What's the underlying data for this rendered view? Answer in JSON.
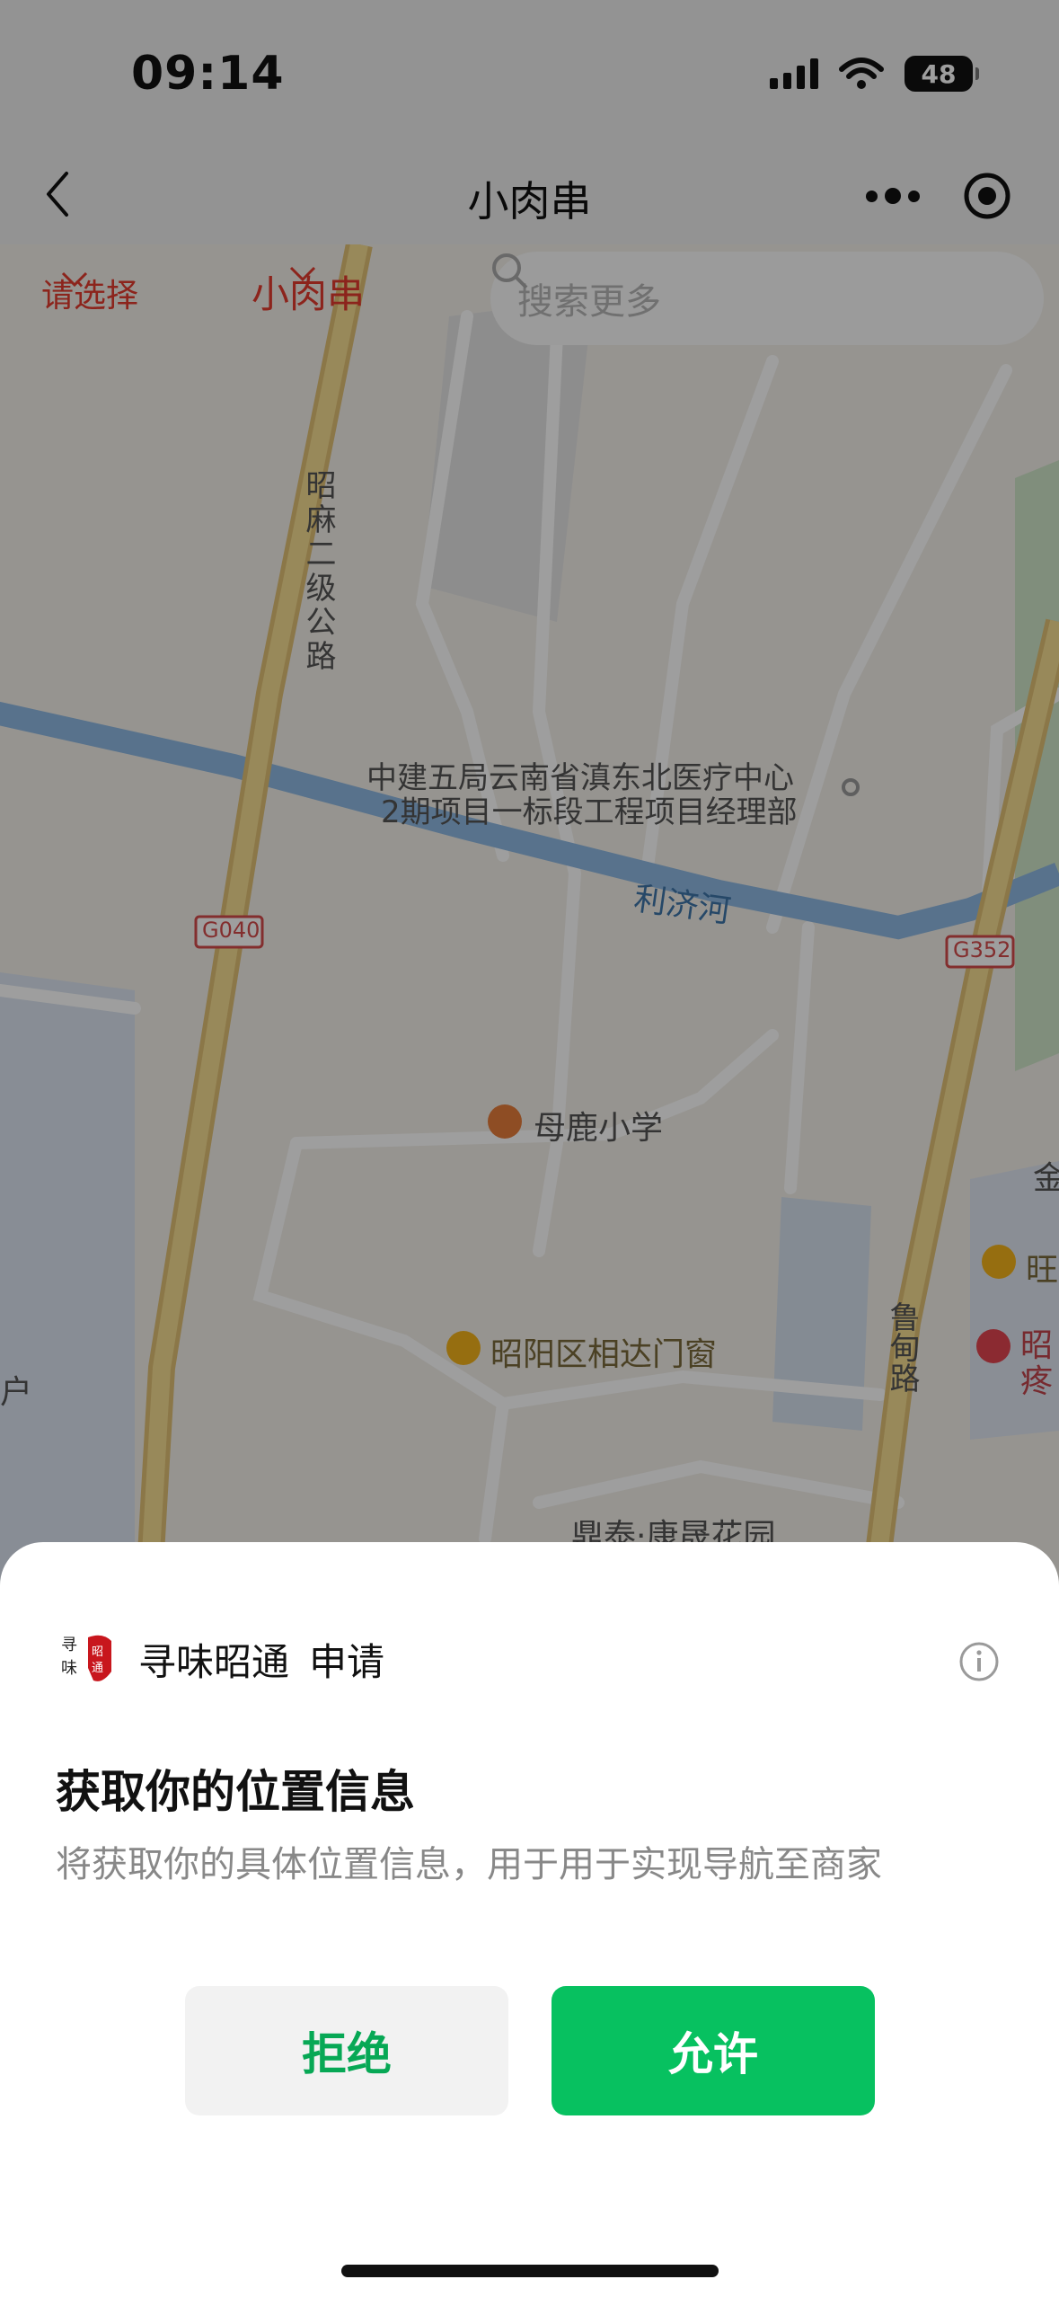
{
  "status_bar": {
    "time": "09:14",
    "battery": "48",
    "icons": [
      "signal-icon",
      "wifi-icon",
      "battery-icon"
    ]
  },
  "nav": {
    "title": "小肉串",
    "icons": [
      "chevron-left-icon",
      "more-icon",
      "target-icon"
    ]
  },
  "filters": {
    "region": "请选择",
    "shop": "小肉串",
    "search_placeholder": "搜索更多"
  },
  "map": {
    "labels": {
      "road_zhaoma": "昭麻二级公路",
      "project": "中建五局云南省滇东北医疗中心",
      "project_2": "2期项目一标段工程项目经理部",
      "river": "利济河",
      "g040": "G040",
      "g352": "G352",
      "school": "母鹿小学",
      "shop_door": "昭阳区相达门窗",
      "road_lu": "鲁甸路",
      "garden": "鼎泰·康晟花园",
      "wang": "旺",
      "zhao": "昭",
      "teng": "疼",
      "jin": "金",
      "lu": "户"
    }
  },
  "dialog": {
    "app_name": "寻味昭通",
    "request_word": "申请",
    "title": "获取你的位置信息",
    "description": "将获取你的具体位置信息，用于用于实现导航至商家",
    "deny_label": "拒绝",
    "allow_label": "允许",
    "colors": {
      "allow_bg": "#07c160",
      "deny_text": "#07a855",
      "accent_red": "#e23b2e"
    }
  }
}
